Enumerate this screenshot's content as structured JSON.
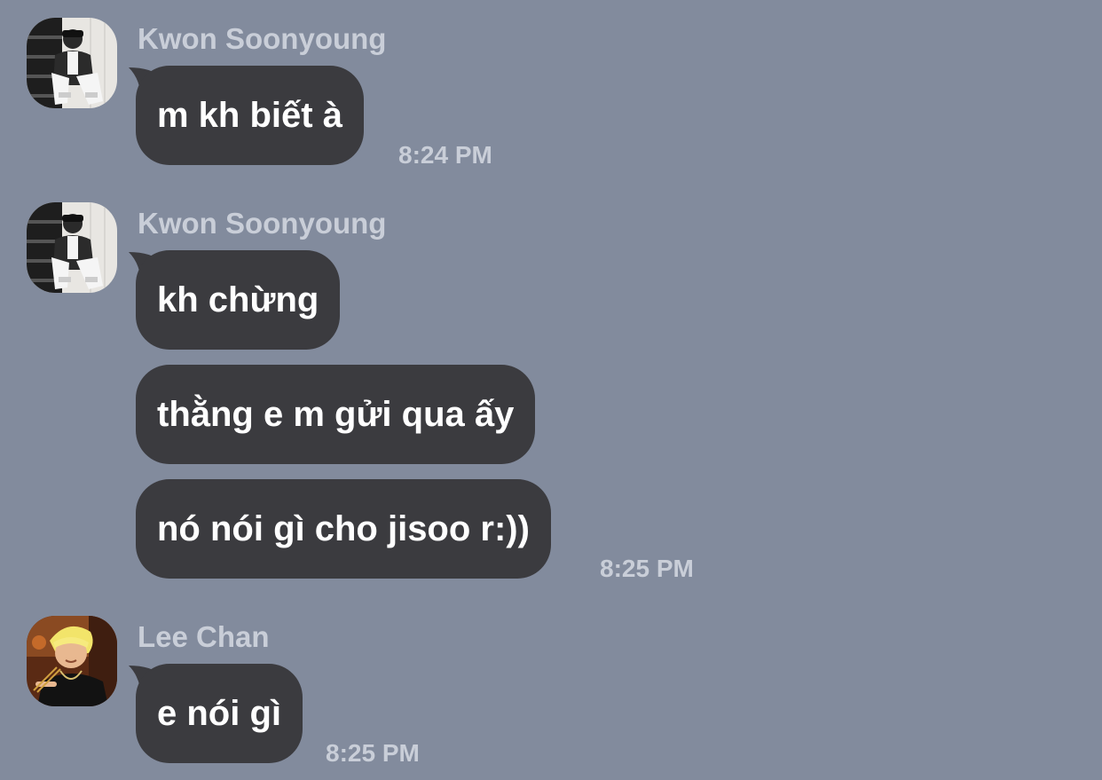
{
  "colors": {
    "background": "#828b9d",
    "bubble": "#3b3b3f",
    "bubble_text": "#ffffff",
    "meta_text": "#c9ced8"
  },
  "groups": [
    {
      "sender": "Kwon Soonyoung",
      "avatar": "avatar-photo-kwon-soonyoung",
      "messages": [
        {
          "text": "m kh biết à",
          "time": "8:24 PM"
        }
      ]
    },
    {
      "sender": "Kwon Soonyoung",
      "avatar": "avatar-photo-kwon-soonyoung",
      "messages": [
        {
          "text": "kh chừng"
        },
        {
          "text": "thằng e m gửi qua ấy"
        },
        {
          "text": "nó nói gì cho jisoo r:))",
          "time": "8:25 PM"
        }
      ]
    },
    {
      "sender": "Lee Chan",
      "avatar": "avatar-photo-lee-chan",
      "messages": [
        {
          "text": "e nói gì",
          "time": "8:25 PM"
        }
      ]
    }
  ]
}
